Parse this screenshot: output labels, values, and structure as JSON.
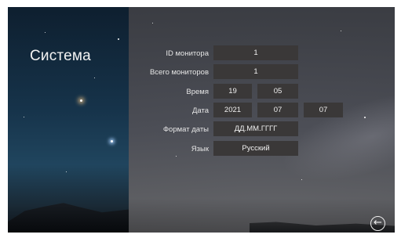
{
  "screen": {
    "title": "Система",
    "fields": {
      "monitor_id": {
        "label": "ID монитора",
        "value": "1"
      },
      "total_monitors": {
        "label": "Всего мониторов",
        "value": "1"
      },
      "time": {
        "label": "Время",
        "hours": "19",
        "minutes": "05"
      },
      "date": {
        "label": "Дата",
        "year": "2021",
        "month": "07",
        "day": "07"
      },
      "date_format": {
        "label": "Формат даты",
        "value": "ДД.ММ.ГГГГ"
      },
      "language": {
        "label": "Язык",
        "value": "Русский"
      }
    },
    "back_icon": "arrow-left-circle-icon"
  },
  "colors": {
    "field_bg": "#3a3838",
    "text": "#f0f0f0"
  }
}
